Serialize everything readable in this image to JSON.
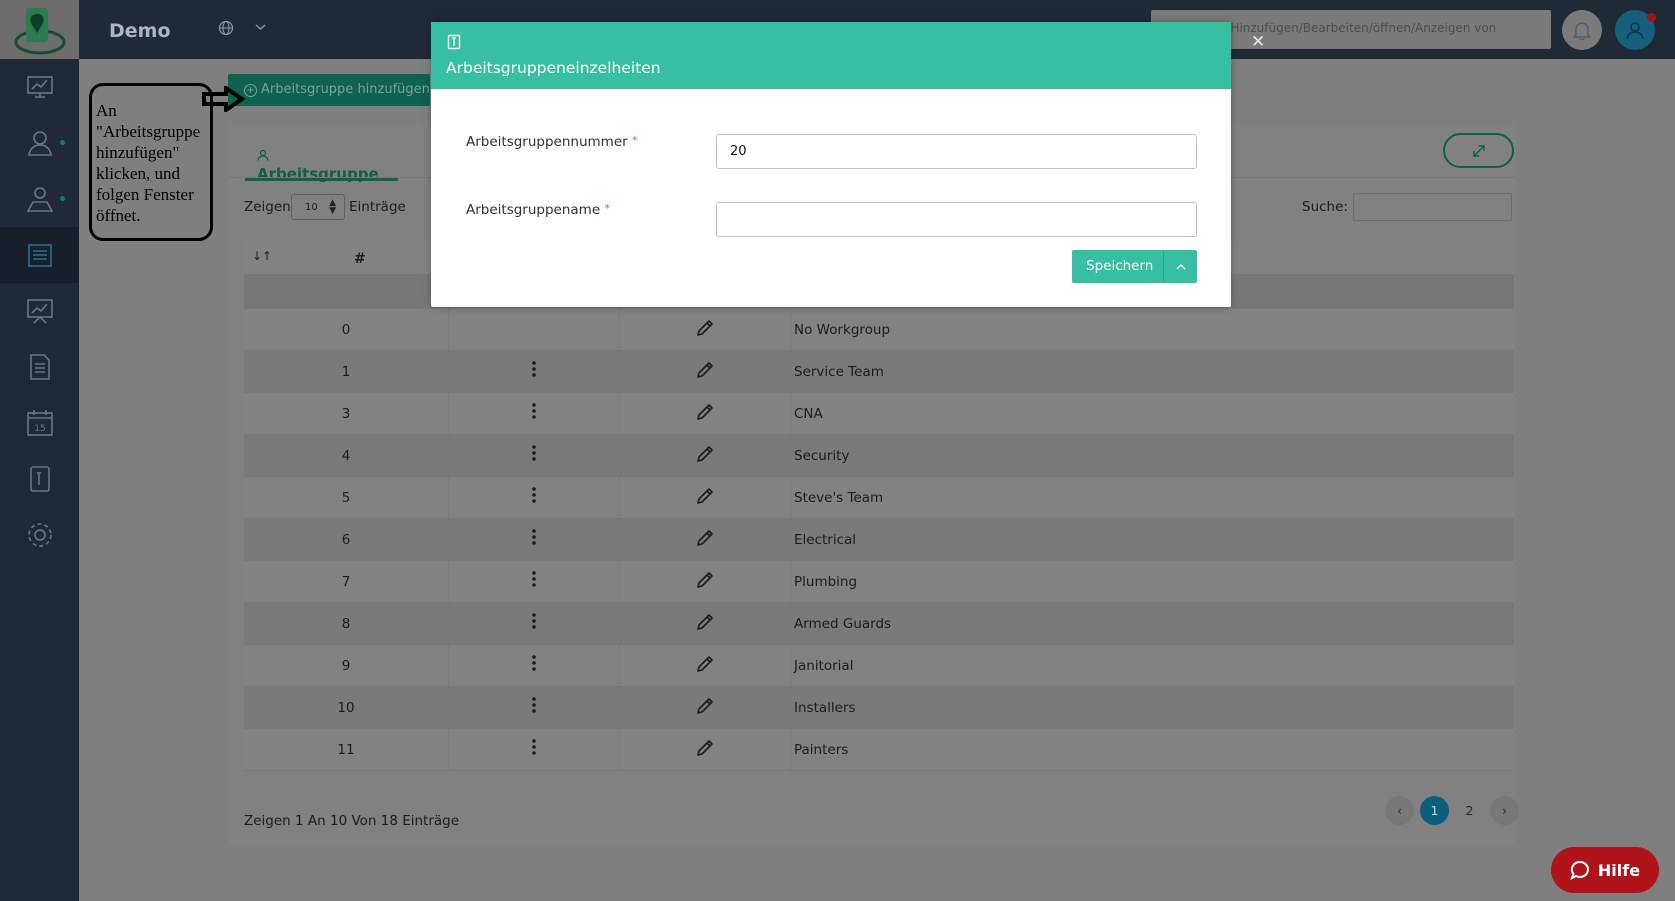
{
  "app": {
    "brand": "Demo",
    "colors": {
      "accent": "#37bfa1",
      "sidebar": "#1f2a36",
      "help": "#b0141a",
      "active_page": "#0b5f7d"
    }
  },
  "topbar": {
    "search_text": "n Hinzufügen/Bearbeiten/öffnen/Anzeigen von",
    "icons": [
      "globe-icon",
      "chevron-down-icon",
      "bell-icon",
      "user-icon"
    ]
  },
  "sidebar": {
    "items": [
      {
        "icon": "dashboard-icon"
      },
      {
        "icon": "users-icon"
      },
      {
        "icon": "map-user-icon"
      },
      {
        "icon": "schedule-icon"
      },
      {
        "icon": "chart-icon"
      },
      {
        "icon": "document-icon"
      },
      {
        "icon": "calendar-icon",
        "label": "15"
      },
      {
        "icon": "id-card-icon"
      },
      {
        "icon": "gear-icon"
      }
    ]
  },
  "page": {
    "add_button": "Arbeitsgruppe hinzufügen",
    "tab": "Arbeitsgruppe",
    "show_label": "Zeigen",
    "show_value": "10",
    "entries_label": "Einträge",
    "search_label": "Suche:",
    "table": {
      "header_hash": "#",
      "rows": [
        {
          "num": "0",
          "has_menu": false,
          "name": "No Workgroup"
        },
        {
          "num": "1",
          "has_menu": true,
          "name": "Service Team"
        },
        {
          "num": "3",
          "has_menu": true,
          "name": "CNA"
        },
        {
          "num": "4",
          "has_menu": true,
          "name": "Security"
        },
        {
          "num": "5",
          "has_menu": true,
          "name": "Steve's Team"
        },
        {
          "num": "6",
          "has_menu": true,
          "name": "Electrical"
        },
        {
          "num": "7",
          "has_menu": true,
          "name": "Plumbing"
        },
        {
          "num": "8",
          "has_menu": true,
          "name": "Armed Guards"
        },
        {
          "num": "9",
          "has_menu": true,
          "name": "Janitorial"
        },
        {
          "num": "10",
          "has_menu": true,
          "name": "Installers"
        },
        {
          "num": "11",
          "has_menu": true,
          "name": "Painters"
        }
      ]
    },
    "footer_info": "Zeigen 1 An 10 Von 18 Einträge",
    "pagination": {
      "pages": [
        "1",
        "2"
      ],
      "current": "1",
      "prev": "‹",
      "next": "›"
    }
  },
  "annotation": {
    "lines": [
      "An",
      "\"Arbeitsgruppe",
      "hinzufügen\"",
      "klicken, und",
      "folgen Fenster",
      "öffnet."
    ]
  },
  "modal": {
    "title": "Arbeitsgruppeneinzelheiten",
    "close": "✕",
    "fields": [
      {
        "label": "Arbeitsgruppennummer",
        "required": "*",
        "value": "20"
      },
      {
        "label": "Arbeitsgruppename",
        "required": "*",
        "value": ""
      }
    ],
    "save_button": "Speichern"
  },
  "help": {
    "label": "Hilfe"
  }
}
